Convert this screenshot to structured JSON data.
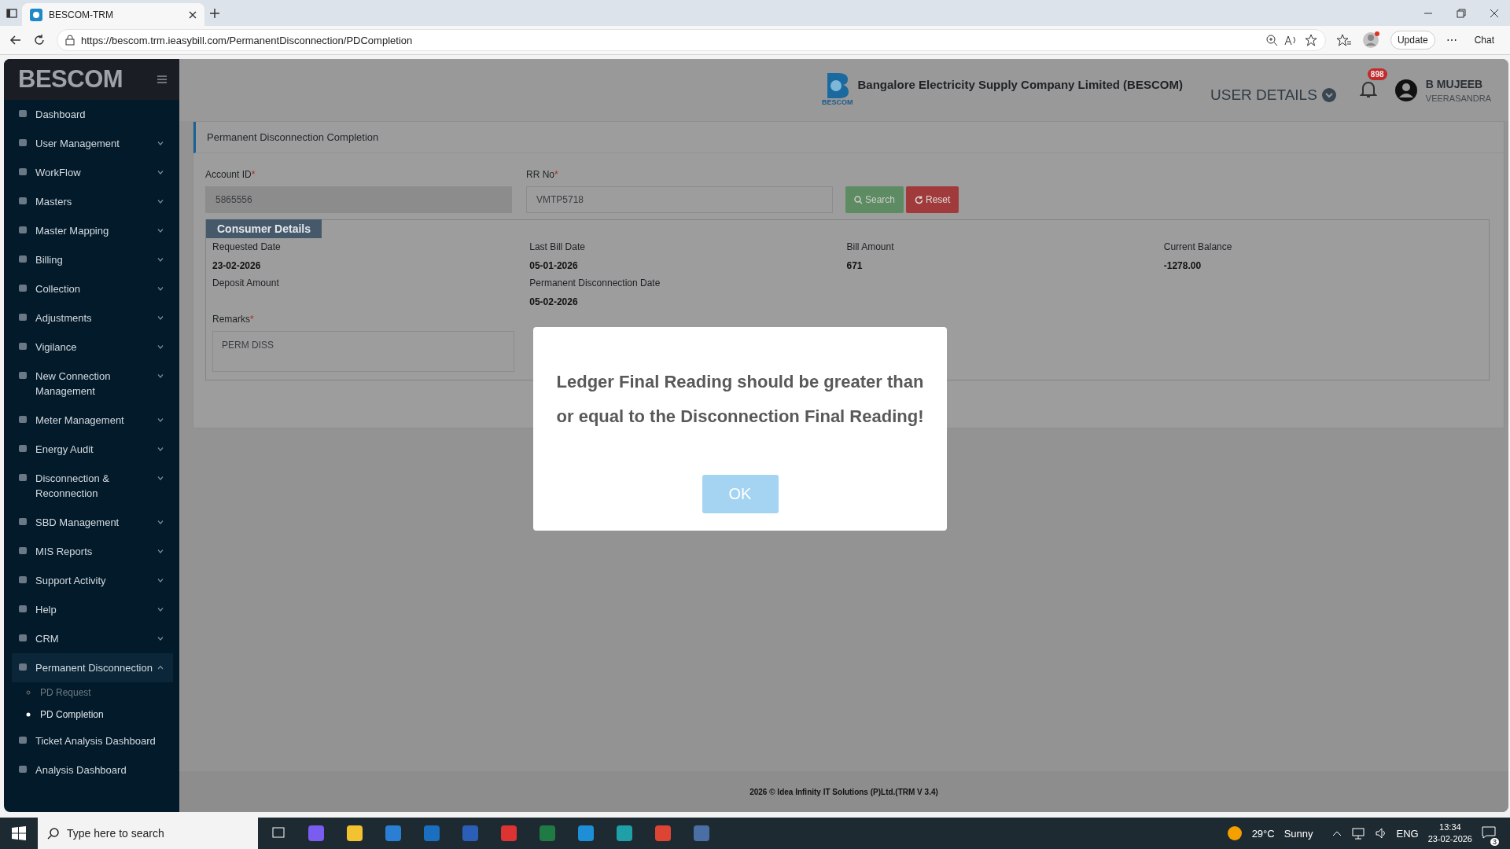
{
  "browser": {
    "tab_title": "BESCOM-TRM",
    "url": "https://bescom.trm.ieasybill.com/PermanentDisconnection/PDCompletion",
    "update_button": "Update",
    "more_button": "⋯",
    "chat_button": "Chat"
  },
  "sidebar": {
    "logo": "BESCOM",
    "items": [
      {
        "label": "Dashboard",
        "expandable": false,
        "expanded": false
      },
      {
        "label": "User Management",
        "expandable": true,
        "expanded": false
      },
      {
        "label": "WorkFlow",
        "expandable": true,
        "expanded": false
      },
      {
        "label": "Masters",
        "expandable": true,
        "expanded": false
      },
      {
        "label": "Master Mapping",
        "expandable": true,
        "expanded": false
      },
      {
        "label": "Billing",
        "expandable": true,
        "expanded": false
      },
      {
        "label": "Collection",
        "expandable": true,
        "expanded": false
      },
      {
        "label": "Adjustments",
        "expandable": true,
        "expanded": false
      },
      {
        "label": "Vigilance",
        "expandable": true,
        "expanded": false
      },
      {
        "label": "New Connection Management",
        "expandable": true,
        "expanded": false
      },
      {
        "label": "Meter Management",
        "expandable": true,
        "expanded": false
      },
      {
        "label": "Energy Audit",
        "expandable": true,
        "expanded": false
      },
      {
        "label": "Disconnection & Reconnection",
        "expandable": true,
        "expanded": false
      },
      {
        "label": "SBD Management",
        "expandable": true,
        "expanded": false
      },
      {
        "label": "MIS Reports",
        "expandable": true,
        "expanded": false
      },
      {
        "label": "Support Activity",
        "expandable": true,
        "expanded": false
      },
      {
        "label": "Help",
        "expandable": true,
        "expanded": false
      },
      {
        "label": "CRM",
        "expandable": true,
        "expanded": false
      },
      {
        "label": "Permanent Disconnection",
        "expandable": true,
        "expanded": true,
        "children": [
          {
            "label": "PD Request",
            "selected": false
          },
          {
            "label": "PD Completion",
            "selected": true
          }
        ]
      },
      {
        "label": "Ticket Analysis Dashboard",
        "expandable": false,
        "expanded": false
      },
      {
        "label": "Analysis Dashboard",
        "expandable": false,
        "expanded": false
      }
    ]
  },
  "header": {
    "company": "Bangalore Electricity Supply Company Limited (BESCOM)",
    "logo_caption": "BESCOM",
    "user_details": "USER DETAILS",
    "notification_count": "898",
    "user_name": "B MUJEEB",
    "user_location": "VEERASANDRA"
  },
  "panel": {
    "title": "Permanent Disconnection Completion",
    "fields": [
      {
        "label": "Account ID",
        "required_mark": "*",
        "value": "5865556",
        "disabled": true
      },
      {
        "label": "RR No",
        "required_mark": "*",
        "value": "VMTP5718",
        "disabled": false
      }
    ],
    "buttons": [
      {
        "kind": "search",
        "label": "Search"
      },
      {
        "kind": "reset",
        "label": "Reset"
      }
    ],
    "consumer_details": {
      "title": "Consumer Details",
      "items": [
        {
          "label": "Requested Date",
          "value": "23-02-2026"
        },
        {
          "label": "Last Bill Date",
          "value": "05-01-2026"
        },
        {
          "label": "Bill Amount",
          "value": "671"
        },
        {
          "label": "Current Balance",
          "value": "-1278.00"
        },
        {
          "label": "Deposit Amount"
        },
        {
          "label": "Permanent Disconnection Date",
          "value": "05-02-2026"
        }
      ],
      "remarks": {
        "label": "Remarks",
        "required_mark": "*",
        "value": "PERM DISS"
      }
    }
  },
  "dialog": {
    "message": "Ledger Final Reading should be greater than or equal to the Disconnection Final Reading!",
    "ok_button": "OK"
  },
  "footer": "2026 © Idea Infinity IT Solutions (P)Ltd.(TRM V 3.4)",
  "taskbar": {
    "search_placeholder": "Type here to search",
    "temperature": "29°C",
    "weather": "Sunny",
    "language": "ENG",
    "time": "13:34",
    "date": "23-02-2026",
    "notification_count": "3"
  }
}
